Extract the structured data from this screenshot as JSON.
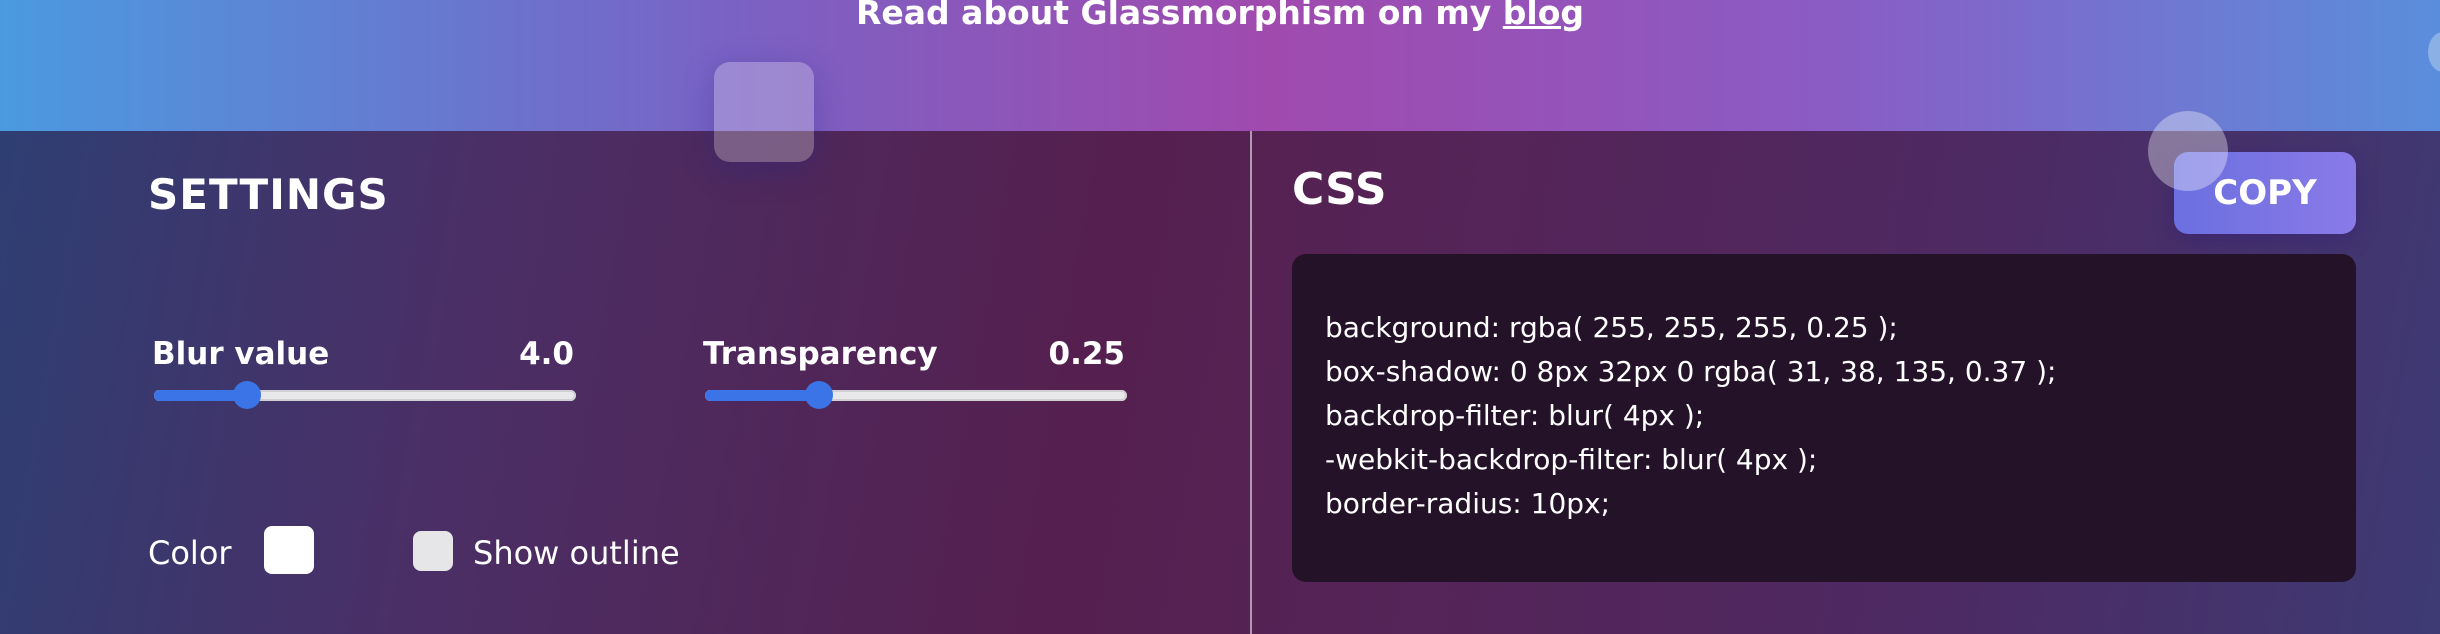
{
  "banner": {
    "text_prefix": "Read about Glassmorphism on my ",
    "link_text": "blog"
  },
  "settings": {
    "title": "SETTINGS",
    "blur": {
      "label": "Blur value",
      "value": "4.0",
      "fraction": 0.22
    },
    "transparency": {
      "label": "Transparency",
      "value": "0.25",
      "fraction": 0.27
    },
    "color": {
      "label": "Color",
      "swatch": "#ffffff"
    },
    "outline": {
      "label": "Show outline",
      "checked": false
    }
  },
  "css_panel": {
    "title": "CSS",
    "copy_label": "COPY",
    "code_lines": [
      "background: rgba( 255, 255, 255, 0.25 );",
      "box-shadow: 0 8px 32px 0 rgba( 31, 38, 135, 0.37 );",
      "backdrop-filter: blur( 4px );",
      "-webkit-backdrop-filter: blur( 4px );",
      "border-radius: 10px;"
    ]
  },
  "colors": {
    "slider_accent": "#3a74e6",
    "code_background": "#241229"
  }
}
